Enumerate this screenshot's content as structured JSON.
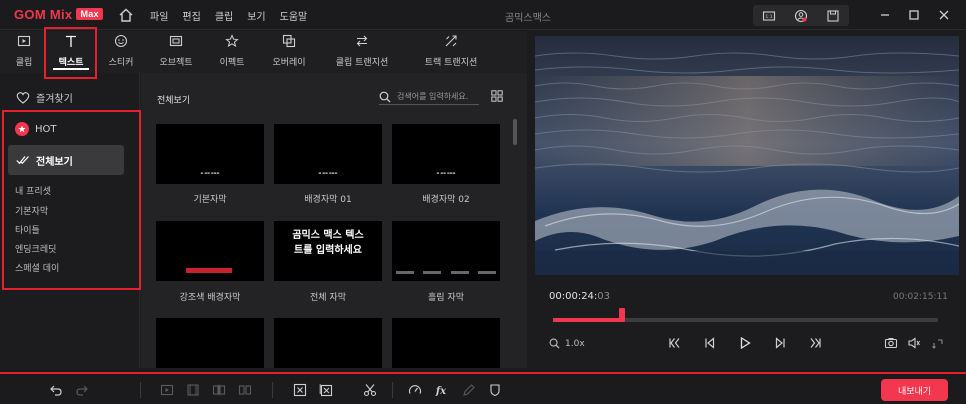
{
  "app": {
    "logo": "GOM Mix",
    "logo_badge": "Max",
    "title": "곰믹스맥스",
    "accent": "#f2374e"
  },
  "menu": [
    "파일",
    "편집",
    "클립",
    "보기",
    "도움말"
  ],
  "category_tabs": [
    {
      "label": "클립",
      "icon": "clip-icon"
    },
    {
      "label": "텍스트",
      "icon": "text-icon",
      "active": true
    },
    {
      "label": "스티커",
      "icon": "sticker-icon"
    },
    {
      "label": "오브젝트",
      "icon": "object-icon"
    },
    {
      "label": "이펙트",
      "icon": "effect-icon"
    },
    {
      "label": "오버레이",
      "icon": "overlay-icon"
    },
    {
      "label": "클립 트랜지션",
      "icon": "clip-transition-icon"
    },
    {
      "label": "트랙 트랜지션",
      "icon": "track-transition-icon"
    }
  ],
  "sidebar": {
    "favorites": "즐겨찾기",
    "hot": "HOT",
    "all": "전체보기",
    "items": [
      "내 프리셋",
      "기본자막",
      "타이틀",
      "엔딩크레딧",
      "스페셜 데이"
    ]
  },
  "content": {
    "title": "전체보기",
    "search_placeholder": "검색어를 입력하세요.",
    "thumb_text": "곰믹스 맥스 텍스트를 입력하세요",
    "thumbnails": [
      {
        "label": "기본자막"
      },
      {
        "label": "배경자막 01"
      },
      {
        "label": "배경자막 02"
      },
      {
        "label": "강조색 배경자막"
      },
      {
        "label": "전체 자막"
      },
      {
        "label": "흘림 자막"
      }
    ]
  },
  "preview": {
    "current_time_main": "00:00:24:",
    "current_time_frames": "03",
    "total_time": "00:02:15:11",
    "seek_progress": 0.18,
    "zoom": "1.0x"
  },
  "bottom": {
    "export_label": "내보내기"
  }
}
